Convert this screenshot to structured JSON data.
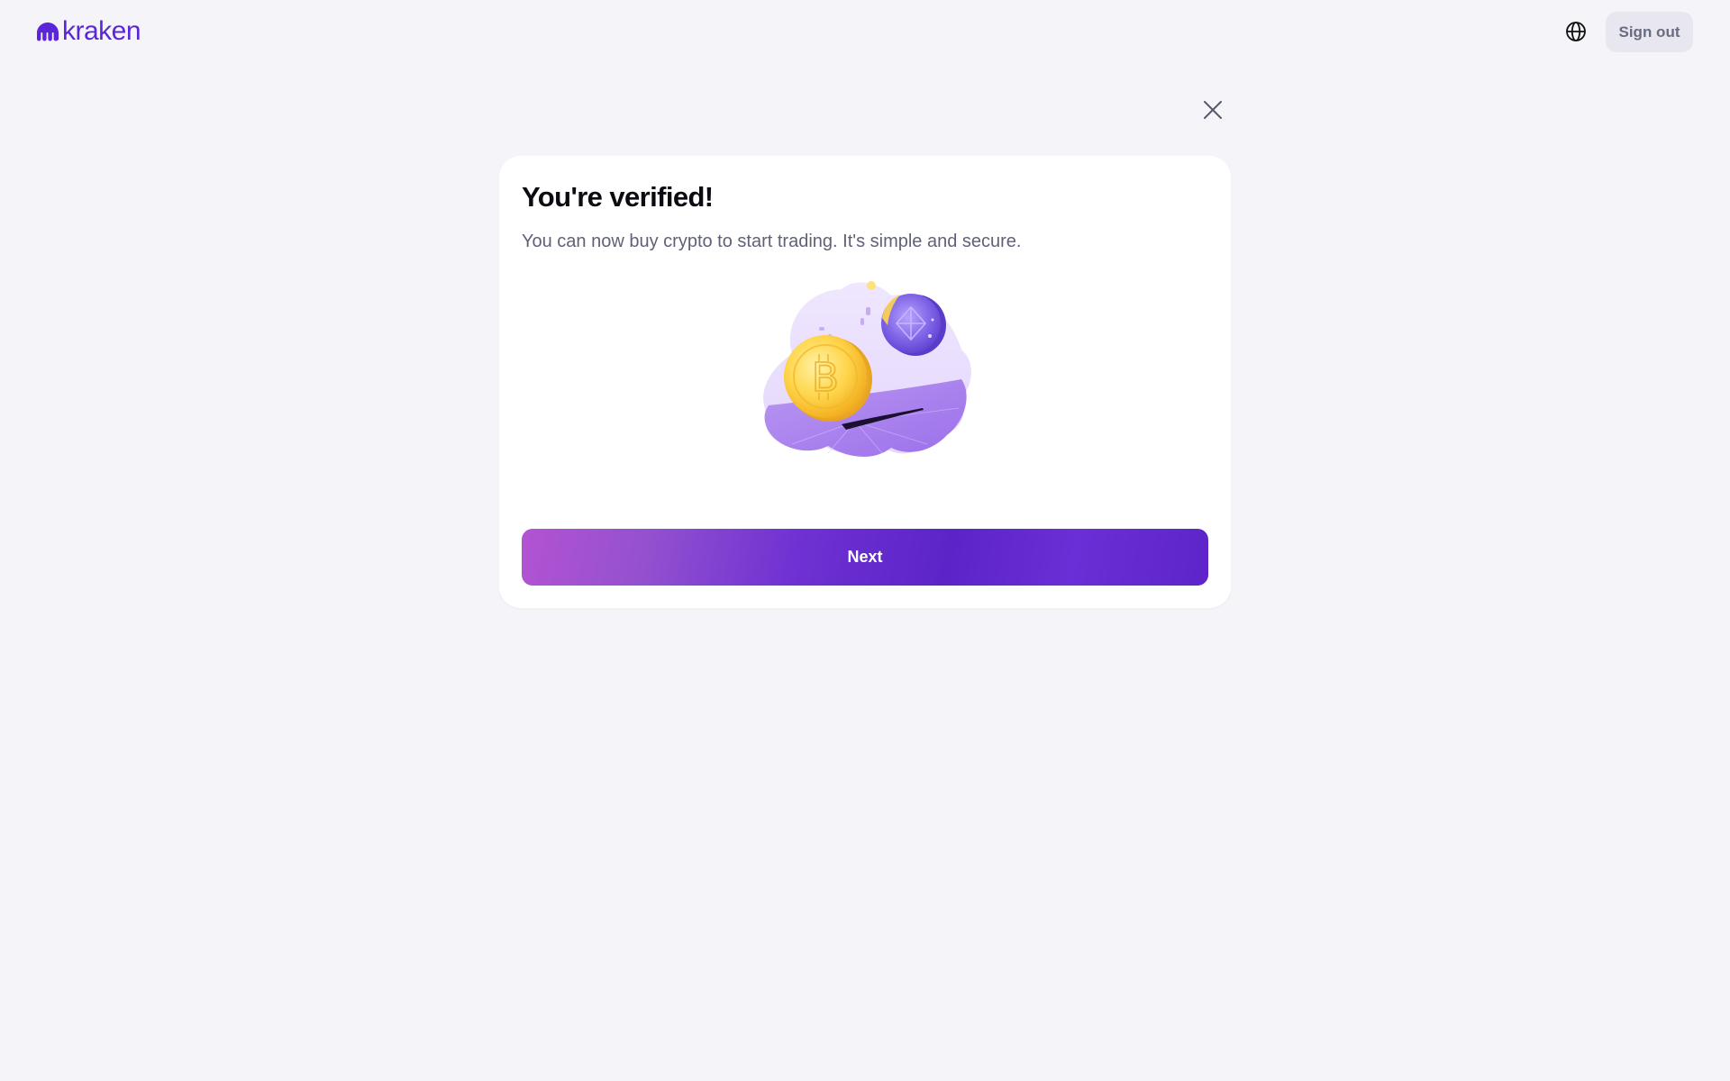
{
  "header": {
    "logo_text": "kraken",
    "language_icon": "globe-icon",
    "sign_out_label": "Sign out"
  },
  "dialog": {
    "close_icon": "close-icon",
    "title": "You're verified!",
    "subtitle": "You can now buy crypto to start trading. It's simple and secure.",
    "illustration": "coins-illustration",
    "next_label": "Next"
  },
  "colors": {
    "brand": "#5b26d9",
    "background": "#f5f5f9",
    "card": "#ffffff",
    "button_start": "#b353d2",
    "button_end": "#5c24c8",
    "signout_bg": "#e8e7ef"
  }
}
